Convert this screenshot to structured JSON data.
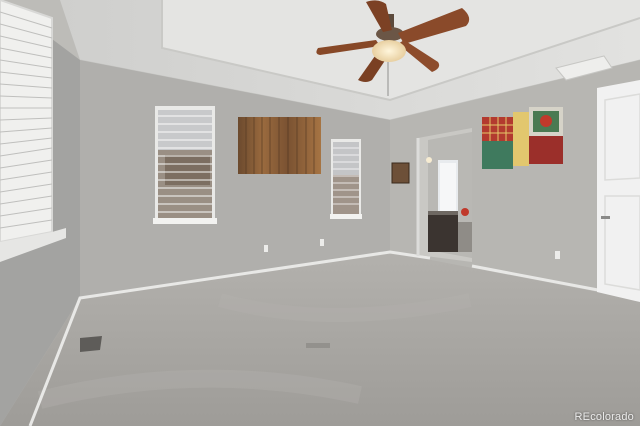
{
  "photo": {
    "watermark": "REcolorado"
  },
  "colors": {
    "wall_left": "#a3a3a1",
    "wall_back": "#b0afac",
    "wall_right": "#b7b6b2",
    "ceiling": "#d9d9d7",
    "carpet": "#a6a4a0",
    "baseboard": "#e8e8e6",
    "fan_blade": "#8a4a2a",
    "fan_light": "#f4e6c8",
    "door": "#f1f1f1"
  }
}
